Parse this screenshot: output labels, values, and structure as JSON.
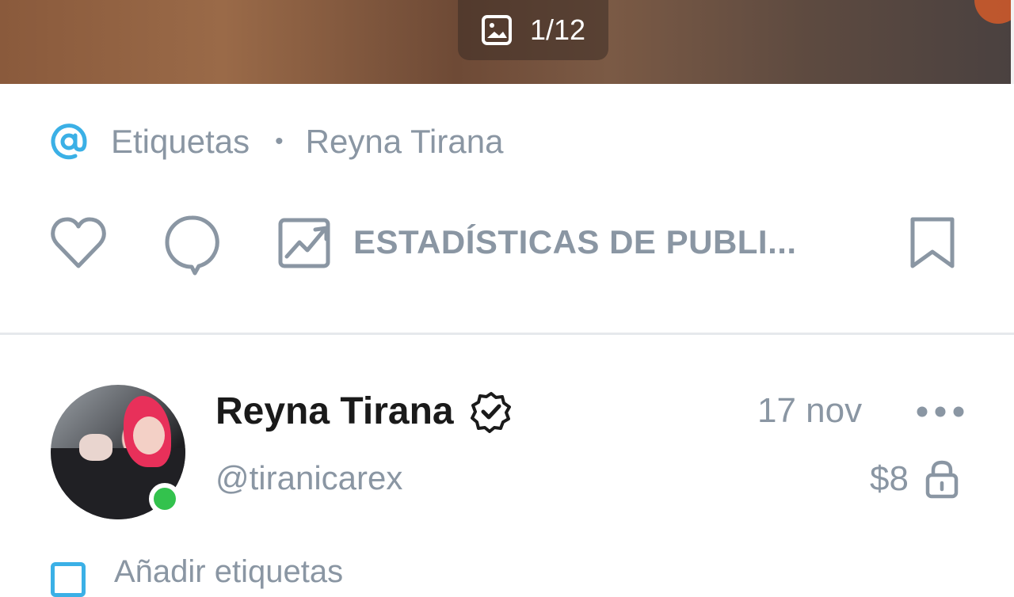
{
  "media": {
    "counter": "1/12",
    "icon": "image-icon"
  },
  "tags": {
    "icon": "at-icon",
    "label": "Etiquetas",
    "separator": "•",
    "tagged_user": "Reyna Tirana"
  },
  "actions": {
    "like_icon": "heart-icon",
    "comment_icon": "comment-icon",
    "stats_icon": "stats-icon",
    "stats_label": "ESTADÍSTICAS DE PUBLI...",
    "bookmark_icon": "bookmark-icon"
  },
  "author": {
    "name": "Reyna Tirana",
    "verified_icon": "verified-icon",
    "handle": "@tiranicarex",
    "online": true,
    "online_color": "#33c24d"
  },
  "post": {
    "date": "17 nov",
    "more_icon": "more-icon",
    "price": "$8",
    "lock_icon": "lock-icon"
  },
  "footer": {
    "add_tags_label": "Añadir etiquetas",
    "add_icon": "add-tag-icon"
  },
  "colors": {
    "accent": "#3bb0e6",
    "muted_text": "#8a96a3",
    "primary_text": "#1a1a1a"
  }
}
